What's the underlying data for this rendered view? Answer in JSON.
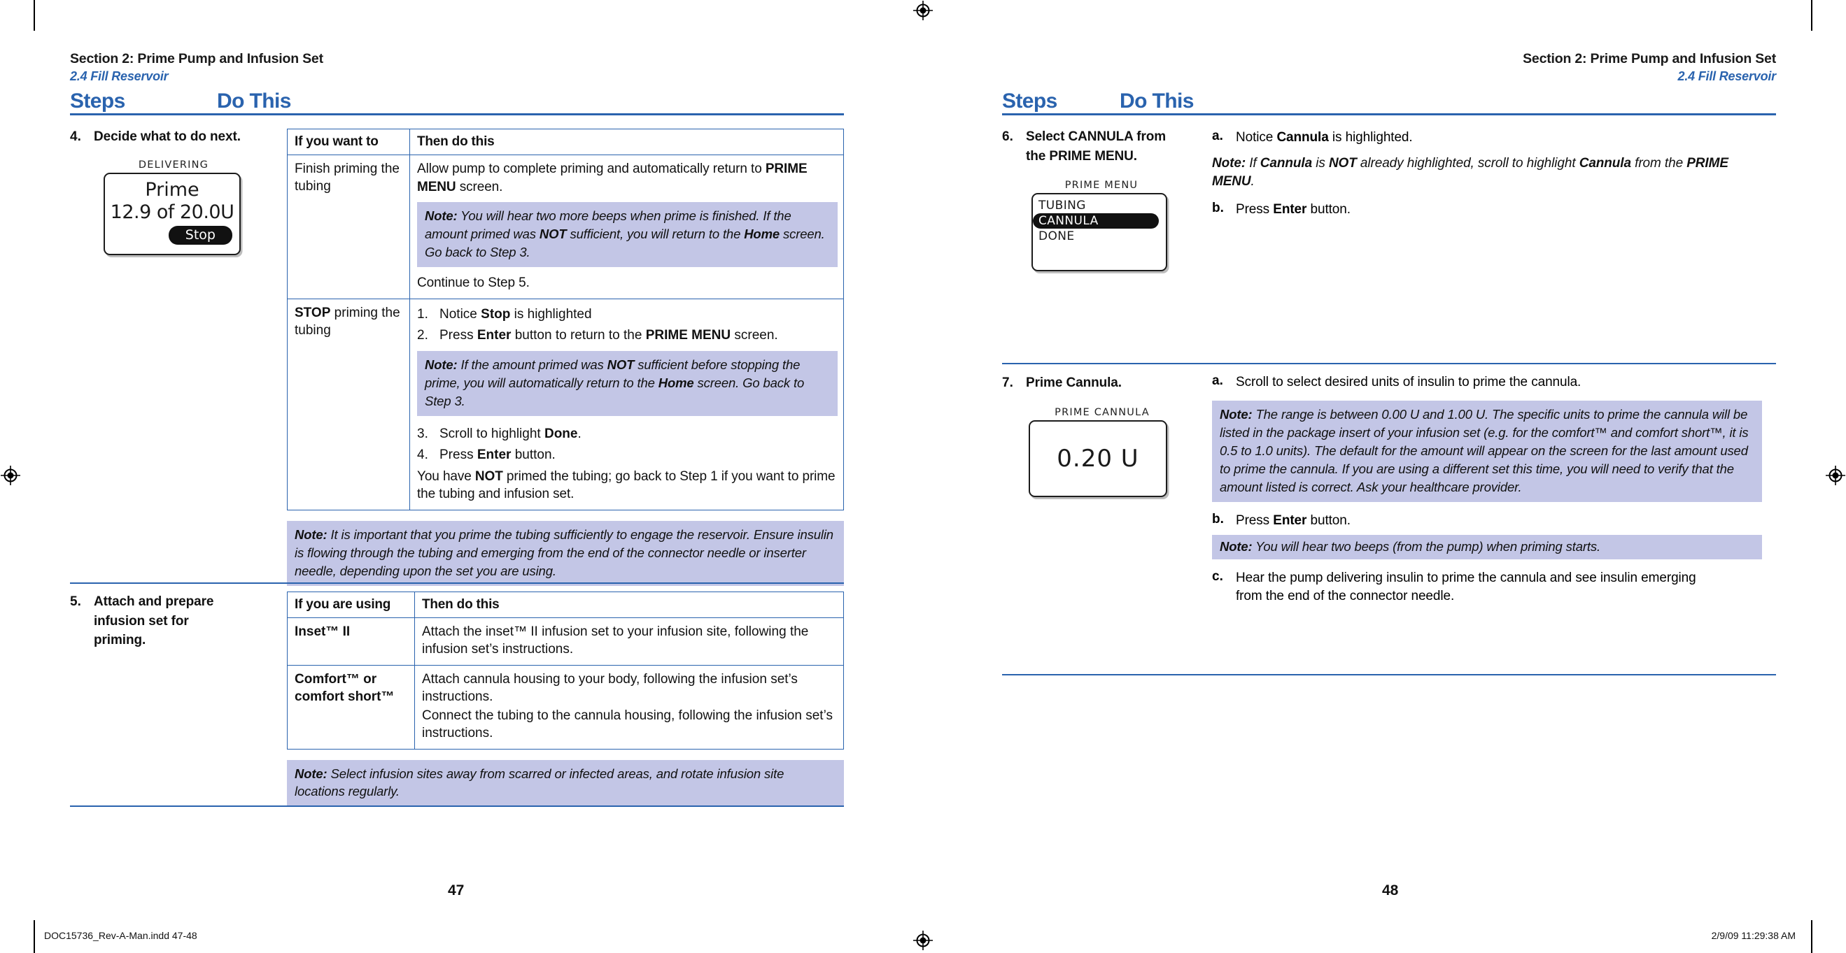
{
  "document": {
    "imprint_left": "DOC15736_Rev-A-Man.indd   47-48",
    "imprint_right": "2/9/09   11:29:38 AM"
  },
  "left_page": {
    "folio": "47",
    "running_head": {
      "title": "Section 2: Prime Pump and Infusion Set",
      "subtitle": "2.4 Fill Reservoir"
    },
    "columns": {
      "steps": "Steps",
      "do_this": "Do This"
    },
    "steps": [
      {
        "number": "4.",
        "title": "Decide what to do next.",
        "pump_screen": {
          "caption": "DELIVERING",
          "title": "Prime",
          "value": "12.9 of 20.0U",
          "button": "Stop"
        },
        "table": {
          "headers": [
            "If you want to",
            "Then do this"
          ],
          "rows": [
            {
              "condition_plain": "Finish priming the tubing",
              "action_lead": "Allow pump to complete priming and automatically return to ",
              "action_bold": "PRIME MENU",
              "action_tail": " screen.",
              "note": {
                "label": "Note:",
                "part1": " You will hear two more beeps when prime is finished. If the amount primed was ",
                "bold1": "NOT",
                "part2": " sufficient, you will return to the ",
                "bold2": "Home",
                "part3": " screen. Go back to Step 3."
              },
              "after": "Continue to Step 5."
            },
            {
              "condition_bold": "STOP",
              "condition_rest": " priming the tubing",
              "list_a": [
                {
                  "marker": "1.",
                  "lead": "Notice ",
                  "bold": "Stop",
                  "tail": " is highlighted"
                },
                {
                  "marker": "2.",
                  "lead": "Press ",
                  "bold": "Enter",
                  "mid": " button to return to the ",
                  "bold2": "PRIME MENU",
                  "tail": " screen."
                }
              ],
              "note": {
                "label": "Note:",
                "part1": " If the amount primed was ",
                "bold1": "NOT",
                "part2": " sufficient before stopping the prime, you will automatically return to the ",
                "bold2": "Home",
                "part3": " screen. Go back to Step 3."
              },
              "list_b": [
                {
                  "marker": "3.",
                  "lead": "Scroll to highlight ",
                  "bold": "Done",
                  "tail": "."
                },
                {
                  "marker": "4.",
                  "lead": "Press ",
                  "bold": "Enter",
                  "tail": " button."
                }
              ],
              "closing_lead": "You have ",
              "closing_bold": "NOT",
              "closing_tail": " primed the tubing; go back to Step 1 if you want to prime the tubing and infusion set."
            }
          ]
        },
        "footer_note": {
          "label": "Note:",
          "text": " It is important that you prime the tubing sufficiently to engage the reservoir. Ensure insulin is flowing through the tubing and emerging from the end of the connector needle or inserter needle, depending upon the set you are using."
        }
      },
      {
        "number": "5.",
        "title": "Attach and prepare infusion set for priming.",
        "table": {
          "headers": [
            "If you are using",
            "Then do this"
          ],
          "rows": [
            {
              "condition": "Inset™ II",
              "action": "Attach the inset™ II infusion set to your infusion site, following the infusion set’s instructions."
            },
            {
              "condition": "Comfort™ or comfort short™",
              "action_line1": "Attach cannula housing to your body, following the infusion set’s instructions.",
              "action_line2": "Connect the tubing to the cannula housing, following the infusion set’s instructions."
            }
          ]
        },
        "footer_note": {
          "label": "Note:",
          "text": " Select infusion sites away from scarred or infected areas, and rotate infusion site locations regularly."
        }
      }
    ]
  },
  "right_page": {
    "folio": "48",
    "running_head": {
      "title": "Section 2: Prime Pump and Infusion Set",
      "subtitle": "2.4 Fill Reservoir"
    },
    "columns": {
      "steps": "Steps",
      "do_this": "Do This"
    },
    "steps": [
      {
        "number": "6.",
        "title": "Select CANNULA from the PRIME MENU.",
        "pump_screen": {
          "caption": "PRIME MENU",
          "items": [
            "TUBING",
            "CANNULA",
            "DONE"
          ],
          "selected_index": 1
        },
        "items": [
          {
            "marker": "a.",
            "lead": "Notice ",
            "bold": "Cannula",
            "tail": " is highlighted."
          }
        ],
        "note": {
          "label": "Note:",
          "part1": " If ",
          "bold1": "Cannula",
          "part2": " is ",
          "bold2": "NOT",
          "part3": " already highlighted, scroll to highlight ",
          "bold3": "Cannula",
          "part4": " from the ",
          "bold4": "PRIME MENU",
          "part5": "."
        },
        "items_after": [
          {
            "marker": "b.",
            "lead": "Press ",
            "bold": "Enter",
            "tail": " button."
          }
        ]
      },
      {
        "number": "7.",
        "title": "Prime Cannula.",
        "pump_screen": {
          "caption": "PRIME CANNULA",
          "value": "0.20 U"
        },
        "items": [
          {
            "marker": "a.",
            "lead": "Scroll to select desired units of insulin to prime the cannula.",
            "bold": "",
            "tail": ""
          }
        ],
        "note_big": {
          "label": "Note:",
          "text": " The range is between 0.00 U and 1.00 U. The specific units to prime the cannula will be listed in the package insert of your infusion set (e.g. for the comfort™ and comfort short™, it is 0.5 to 1.0 units). The default for the amount will appear on the screen for the last amount used to prime the cannula. If you are using a different set this time, you will need to verify that the amount listed is correct. Ask your healthcare provider."
        },
        "items_after": [
          {
            "marker": "b.",
            "lead": "Press ",
            "bold": "Enter",
            "tail": " button."
          }
        ],
        "note_small": {
          "label": "Note:",
          "text": " You will hear two beeps (from the pump) when priming starts."
        },
        "items_last": [
          {
            "marker": "c.",
            "lead": "Hear the pump delivering insulin to prime the cannula and see insulin emerging from the end of the connector needle.",
            "bold": "",
            "tail": ""
          }
        ]
      }
    ]
  },
  "colors": {
    "heading_blue": "#2a63ae",
    "note_bg": "#c3c6e6",
    "text": "#111111"
  }
}
